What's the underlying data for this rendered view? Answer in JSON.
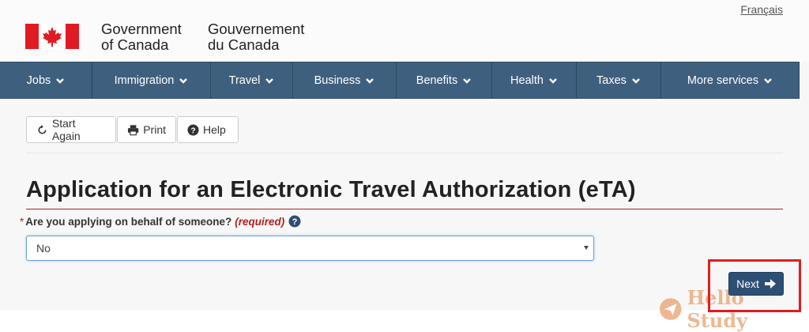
{
  "header": {
    "gov_name_en_line1": "Government",
    "gov_name_en_line2": "of Canada",
    "gov_name_fr_line1": "Gouvernement",
    "gov_name_fr_line2": "du Canada",
    "language_link": "Français",
    "flag_icon": "canada-flag-icon",
    "flag_red": "#e11b22"
  },
  "nav": {
    "items": [
      {
        "label": "Jobs"
      },
      {
        "label": "Immigration"
      },
      {
        "label": "Travel"
      },
      {
        "label": "Business"
      },
      {
        "label": "Benefits"
      },
      {
        "label": "Health"
      },
      {
        "label": "Taxes"
      },
      {
        "label": "More services"
      }
    ],
    "background": "#3f5f7e"
  },
  "toolbar": {
    "start_again_label": "Start Again",
    "print_label": "Print",
    "help_label": "Help"
  },
  "main": {
    "title": "Application for an Electronic Travel Authorization (eTA)",
    "question": {
      "required_marker": "*",
      "label": "Are you applying on behalf of someone?",
      "required_text": "(required)",
      "help_icon": "question-circle-icon"
    },
    "select": {
      "value": "No"
    },
    "next_label": "Next",
    "next_icon": "arrow-right-icon",
    "highlight_color": "#e01d1d"
  },
  "watermark": {
    "text": "Hello Study",
    "icon": "paper-plane-icon"
  }
}
